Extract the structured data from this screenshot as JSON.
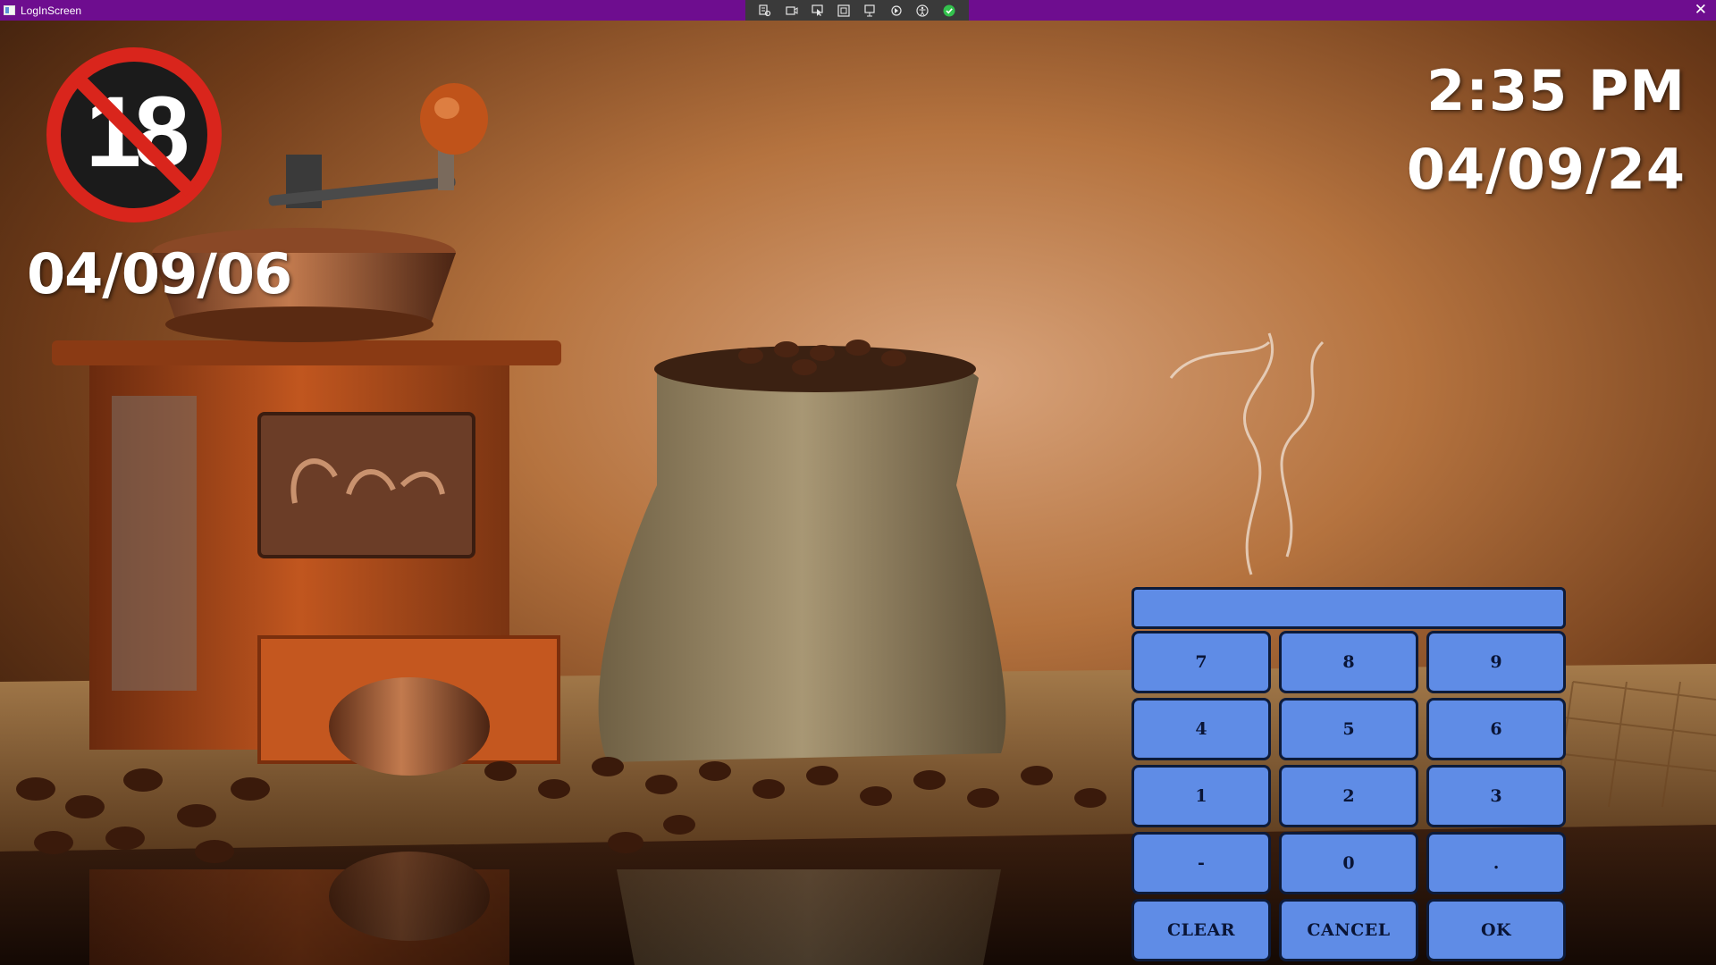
{
  "window": {
    "title": "LogInScreen",
    "close_glyph": "✕",
    "toolbar_icons": [
      "live-visual-tree-icon",
      "record-icon",
      "select-element-icon",
      "display-layout-adorners-icon",
      "track-focus-icon",
      "hot-reload-icon",
      "accessibility-icon",
      "binding-status-icon"
    ]
  },
  "age_check": {
    "badge_number": "18",
    "cutoff_date": "04/09/06"
  },
  "clock": {
    "time": "2:35 PM",
    "date": "04/09/24"
  },
  "pin_entry": {
    "value": ""
  },
  "keypad": {
    "keys": [
      "7",
      "8",
      "9",
      "4",
      "5",
      "6",
      "1",
      "2",
      "3",
      "-",
      "0",
      ".",
      "CLEAR",
      "CANCEL",
      "OK"
    ]
  },
  "colors": {
    "titlebar": "#6e0d8f",
    "key_fill": "#5f8ce6",
    "key_border": "#0d1b3a",
    "prohibition_red": "#d9251c"
  }
}
